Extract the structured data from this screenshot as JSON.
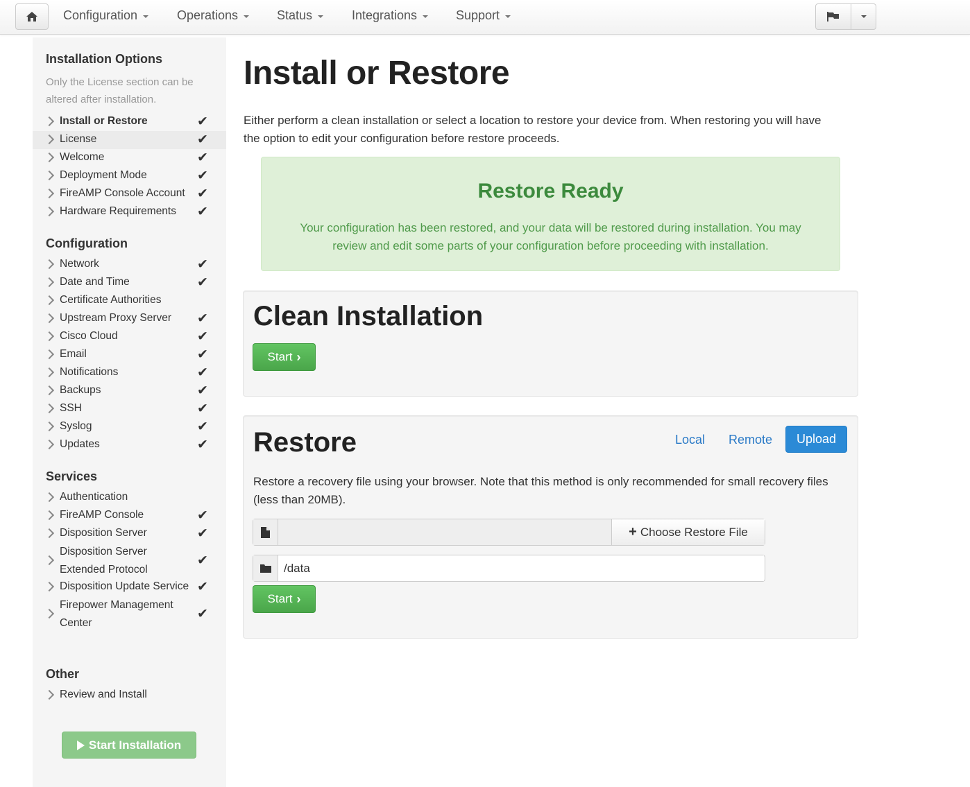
{
  "navbar": {
    "menus": [
      {
        "label": "Configuration"
      },
      {
        "label": "Operations"
      },
      {
        "label": "Status"
      },
      {
        "label": "Integrations"
      },
      {
        "label": "Support"
      }
    ],
    "icons": {
      "home": "home-icon",
      "flag": "flag-icon"
    }
  },
  "sidebar": {
    "sections": [
      {
        "heading": "Installation Options",
        "note": "Only the License section can be altered after installation.",
        "items": [
          {
            "label": "Install or Restore",
            "checked": true,
            "bold": true
          },
          {
            "label": "License",
            "checked": true,
            "active": true
          },
          {
            "label": "Welcome",
            "checked": true
          },
          {
            "label": "Deployment Mode",
            "checked": true
          },
          {
            "label": "FireAMP Console Account",
            "checked": true
          },
          {
            "label": "Hardware Requirements",
            "checked": true
          }
        ]
      },
      {
        "heading": "Configuration",
        "items": [
          {
            "label": "Network",
            "checked": true
          },
          {
            "label": "Date and Time",
            "checked": true
          },
          {
            "label": "Certificate Authorities",
            "checked": false
          },
          {
            "label": "Upstream Proxy Server",
            "checked": true
          },
          {
            "label": "Cisco Cloud",
            "checked": true
          },
          {
            "label": "Email",
            "checked": true
          },
          {
            "label": "Notifications",
            "checked": true
          },
          {
            "label": "Backups",
            "checked": true
          },
          {
            "label": "SSH",
            "checked": true
          },
          {
            "label": "Syslog",
            "checked": true
          },
          {
            "label": "Updates",
            "checked": true
          }
        ]
      },
      {
        "heading": "Services",
        "items": [
          {
            "label": "Authentication",
            "checked": false
          },
          {
            "label": "FireAMP Console",
            "checked": true
          },
          {
            "label": "Disposition Server",
            "checked": true
          },
          {
            "label": "Disposition Server Extended Protocol",
            "checked": true
          },
          {
            "label": "Disposition Update Service",
            "checked": true
          },
          {
            "label": "Firepower Management Center",
            "checked": true
          }
        ]
      },
      {
        "heading": "Other",
        "items": [
          {
            "label": "Review and Install",
            "checked": false
          }
        ]
      }
    ],
    "start_installation": "Start Installation"
  },
  "main": {
    "title": "Install or Restore",
    "intro": "Either perform a clean installation or select a location to restore your device from. When restoring you will have the option to edit your configuration before restore proceeds.",
    "alert": {
      "title": "Restore Ready",
      "text": "Your configuration has been restored, and your data will be restored during installation. You may review and edit some parts of your configuration before proceeding with installation.",
      "color": "#dff0d8"
    },
    "clean": {
      "title": "Clean Installation",
      "start_label": "Start"
    },
    "restore": {
      "title": "Restore",
      "tabs": [
        "Local",
        "Remote",
        "Upload"
      ],
      "active_tab": "Upload",
      "description": "Restore a recovery file using your browser. Note that this method is only recommended for small recovery files (less than 20MB).",
      "file_value": "",
      "choose_label": "Choose Restore File",
      "path_value": "/data",
      "start_label": "Start"
    }
  },
  "colors": {
    "accent": "#2b8ad6",
    "success": "#4aa64a",
    "success_text": "#3c8a3d"
  }
}
